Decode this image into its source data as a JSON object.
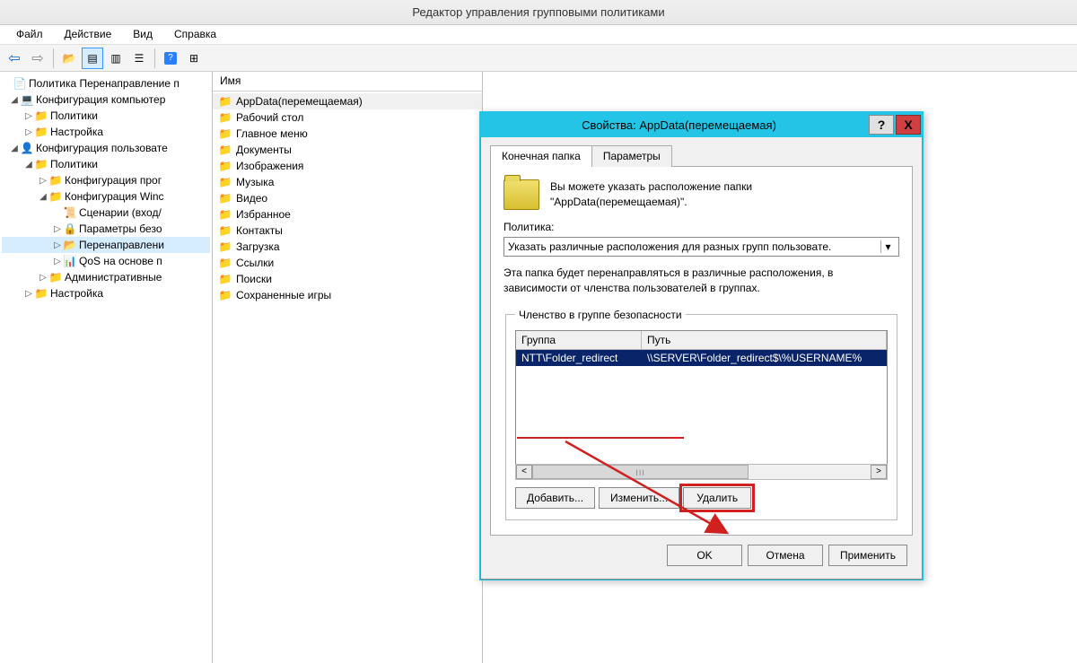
{
  "window": {
    "title": "Редактор управления групповыми политиками"
  },
  "menubar": {
    "file": "Файл",
    "action": "Действие",
    "view": "Вид",
    "help": "Справка"
  },
  "tree": {
    "root": "Политика Перенаправление п",
    "comp_cfg": "Конфигурация компьютер",
    "comp_policies": "Политики",
    "comp_settings": "Настройка",
    "user_cfg": "Конфигурация пользовате",
    "user_policies": "Политики",
    "user_cfg_prog": "Конфигурация прог",
    "user_cfg_win": "Конфигурация Winc",
    "scen": "Сценарии (вход/",
    "sec_params": "Параметры безо",
    "redirect": "Перенаправлени",
    "qos": "QoS на основе п",
    "admin_tmpl": "Административные",
    "user_settings": "Настройка"
  },
  "filelist": {
    "header_name": "Имя",
    "items": [
      "AppData(перемещаемая)",
      "Рабочий стол",
      "Главное меню",
      "Документы",
      "Изображения",
      "Музыка",
      "Видео",
      "Избранное",
      "Контакты",
      "Загрузка",
      "Ссылки",
      "Поиски",
      "Сохраненные игры"
    ]
  },
  "dialog": {
    "title": "Свойства: AppData(перемещаемая)",
    "help_char": "?",
    "close_char": "X",
    "tabs": {
      "target": "Конечная папка",
      "settings": "Параметры"
    },
    "info_line1": "Вы можете указать расположение папки",
    "info_line2": "\"AppData(перемещаемая)\".",
    "policy_label": "Политика:",
    "policy_value": "Указать различные расположения для разных групп пользовате.",
    "desc": "Эта папка будет перенаправляться в различные расположения, в зависимости от членства пользователей в группах.",
    "group_box_legend": "Членство в группе безопасности",
    "col_group": "Группа",
    "col_path": "Путь",
    "row_group": "NTT\\Folder_redirect",
    "row_path": "\\\\SERVER\\Folder_redirect$\\%USERNAME%",
    "scroll_handle": "III",
    "btn_add": "Добавить...",
    "btn_edit": "Изменить...",
    "btn_delete": "Удалить",
    "btn_ok": "OK",
    "btn_cancel": "Отмена",
    "btn_apply": "Применить"
  }
}
